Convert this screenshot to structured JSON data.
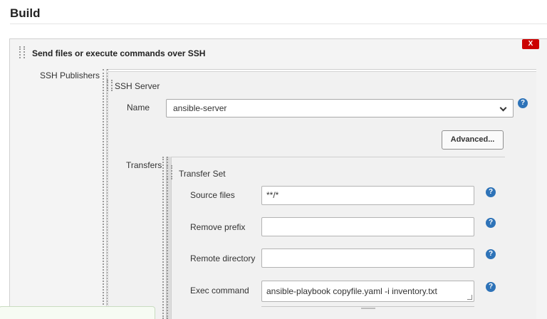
{
  "section": {
    "title": "Build"
  },
  "builder": {
    "title": "Send files or execute commands over SSH",
    "delete_label": "X",
    "ssh_publishers_label": "SSH Publishers",
    "ssh_server_label": "SSH Server",
    "name": {
      "label": "Name",
      "selected": "ansible-server"
    },
    "advanced_label": "Advanced...",
    "transfers_label": "Transfers",
    "transfer_set": {
      "title": "Transfer Set",
      "source_files": {
        "label": "Source files",
        "value": "**/*"
      },
      "remove_prefix": {
        "label": "Remove prefix",
        "value": ""
      },
      "remote_directory": {
        "label": "Remote directory",
        "value": ""
      },
      "exec_command": {
        "label": "Exec command",
        "value": "ansible-playbook copyfile.yaml -i inventory.txt"
      }
    },
    "help_glyph": "?"
  },
  "colors": {
    "help": "#2e73b8",
    "delete": "#cc0000"
  },
  "icons": [
    "drag-handle-icon",
    "help-icon",
    "chevron-down-icon",
    "resize-grip-icon"
  ]
}
